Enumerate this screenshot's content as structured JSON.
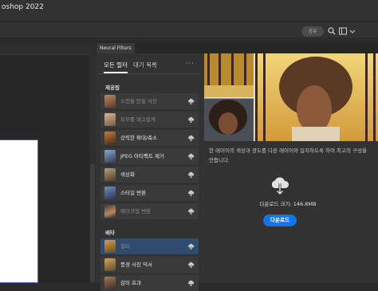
{
  "app": {
    "title": "oshop 2022"
  },
  "toolbar": {
    "share_label": "공유"
  },
  "panel": {
    "tab_label": "Neural Filters",
    "tabs": [
      {
        "label": "모든 필터"
      },
      {
        "label": "대기 목록"
      }
    ],
    "more_label": "···",
    "sections": [
      {
        "label": "제공됨",
        "items": [
          {
            "label": "스킨을 만들 사진",
            "state": "dim"
          },
          {
            "label": "피부를 매끄럽게",
            "state": "dim"
          },
          {
            "label": "강력한 확대/축소",
            "state": "bright"
          },
          {
            "label": "JPEG 아티팩트 제거",
            "state": "bright"
          },
          {
            "label": "색상화",
            "state": "bright"
          },
          {
            "label": "스타일 변환",
            "state": "bright"
          },
          {
            "label": "메이크업 변환",
            "state": "dim"
          }
        ]
      },
      {
        "label": "베타",
        "items": [
          {
            "label": "필터",
            "state": "dim",
            "selected": true
          },
          {
            "label": "풍경 사진 믹서",
            "state": "bright"
          },
          {
            "label": "감미 효과",
            "state": "bright"
          }
        ]
      }
    ]
  },
  "detail": {
    "description": "한 레이어의 색상과 광도를 다른 레이어와 일치하도록 하여 최고의 구성을 만듭니다.",
    "download_size": "다운로드 크기: 146.8MB",
    "download_button": "다운로드"
  },
  "colors": {
    "accent": "#1473e6",
    "selected_row": "#2f4b6e",
    "panel_bg": "#323232"
  },
  "icons": {
    "cloud": "cloud-download-icon",
    "search": "search-icon",
    "workspace": "workspace-icon"
  }
}
